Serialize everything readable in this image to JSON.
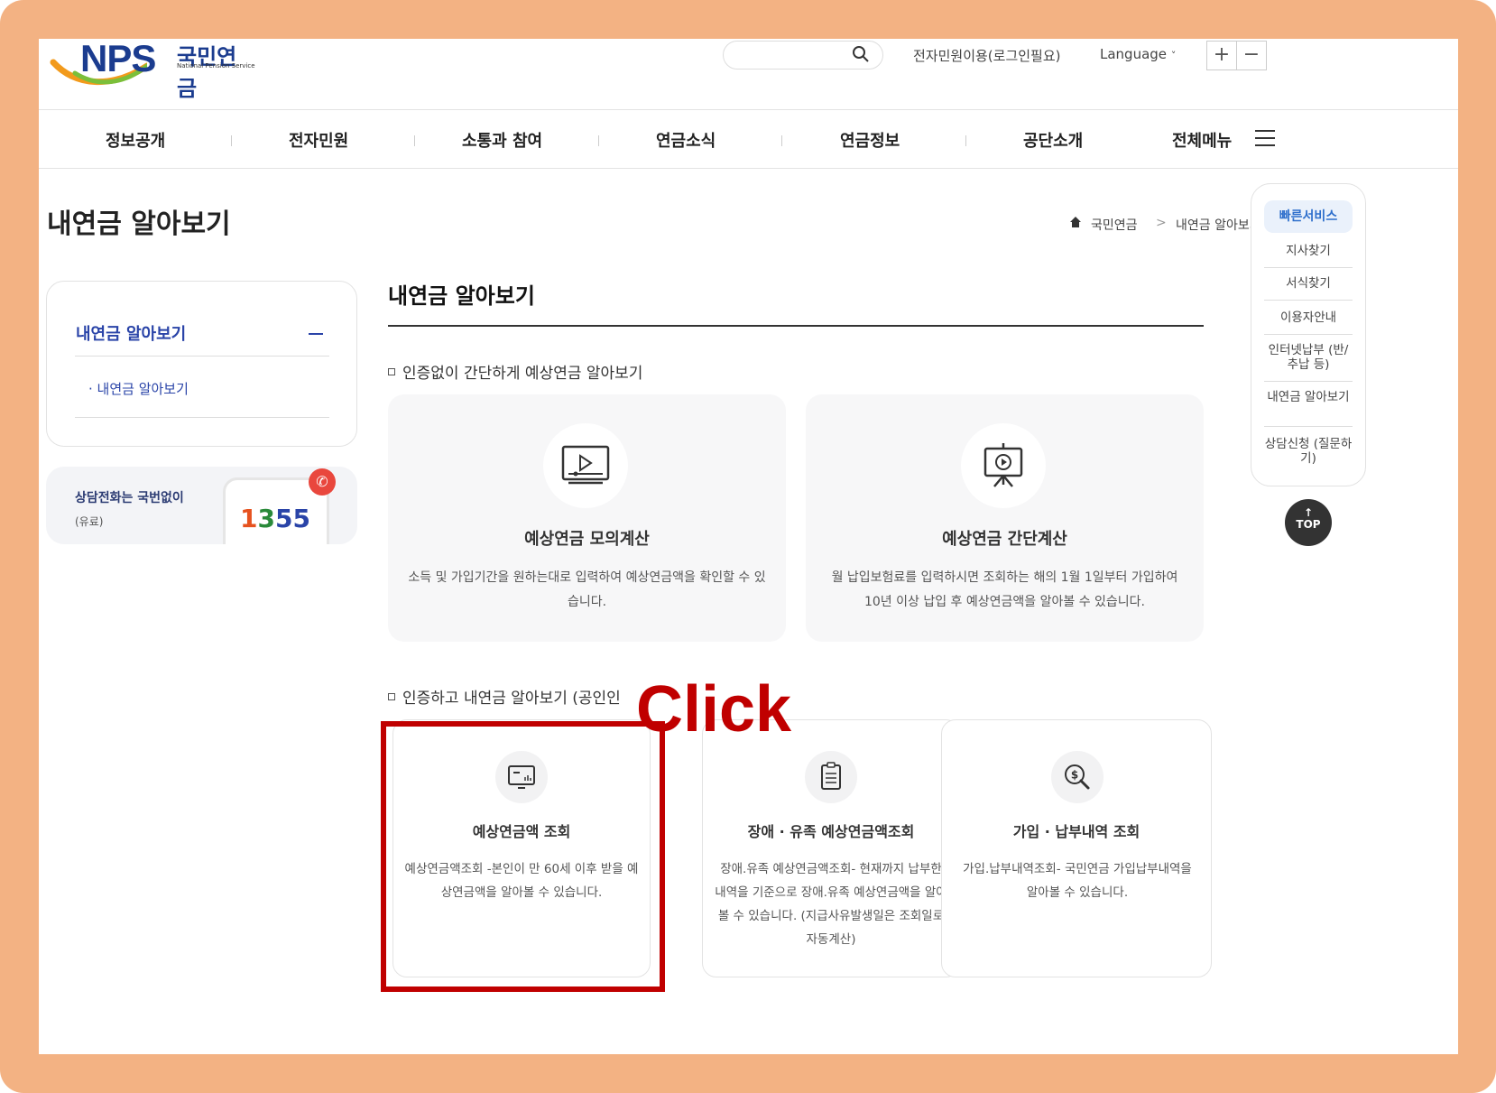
{
  "header": {
    "logo_text": "NPS",
    "logo_kr": "국민연금",
    "logo_en": "National Pension Service",
    "eservice_link": "전자민원이용(로그인필요)",
    "language": "Language",
    "zoom_in": "+",
    "zoom_out": "−"
  },
  "gnb": [
    "정보공개",
    "전자민원",
    "소통과 참여",
    "연금소식",
    "연금정보",
    "공단소개",
    "전체메뉴"
  ],
  "page_title": "내연금 알아보기",
  "breadcrumb": {
    "home": "국민연금",
    "current": "내연금 알아보기"
  },
  "lnb": {
    "title": "내연금 알아보기",
    "sub": "· 내연금 알아보기"
  },
  "call": {
    "line1": "상담전화는 국번없이",
    "line2": "(유료)",
    "num1": "1",
    "num2": "3",
    "num3": "55"
  },
  "content": {
    "heading": "내연금 알아보기",
    "section1": "인증없이 간단하게 예상연금 알아보기",
    "section2": "인증하고 내연금 알아보기 (공인인",
    "cards1": [
      {
        "title": "예상연금 모의계산",
        "desc": "소득 및 가입기간을 원하는대로 입력하여 예상연금액을 확인할 수 있습니다.",
        "icon": "video-monitor-icon"
      },
      {
        "title": "예상연금 간단계산",
        "desc": "월 납입보험료를 입력하시면 조회하는 해의 1월 1일부터 가입하여 10년 이상 납입 후 예상연금액을 알아볼 수 있습니다.",
        "icon": "presentation-board-icon"
      }
    ],
    "cards2": [
      {
        "title": "예상연금액 조회",
        "desc": "예상연금액조회 -본인이 만 60세 이후 받을 예상연금액을 알아볼 수 있습니다.",
        "icon": "monitor-chart-icon"
      },
      {
        "title": "장애 · 유족 예상연금액조회",
        "desc": "장애.유족 예상연금액조회- 현재까지 납부한 내역을 기준으로 장애.유족 예상연금액을 알아볼 수 있습니다. (지급사유발생일은 조회일로 자동계산)",
        "icon": "clipboard-icon"
      },
      {
        "title": "가입 · 납부내역 조회",
        "desc": "가입.납부내역조회- 국민연금 가입납부내역을 알아볼 수 있습니다.",
        "icon": "money-search-icon"
      }
    ]
  },
  "quick": {
    "head": "빠른서비스",
    "items": [
      "지사찾기",
      "서식찾기",
      "이용자안내",
      "인터넷납부 (반/추납 등)",
      "내연금 알아보기",
      "상담신청 (질문하기)"
    ],
    "top": "TOP"
  },
  "annotation": {
    "label": "Click",
    "color": "#c00000"
  },
  "colors": {
    "frame": "#f3b283",
    "brand": "#1b3c8f",
    "accent": "#2a44a8"
  }
}
